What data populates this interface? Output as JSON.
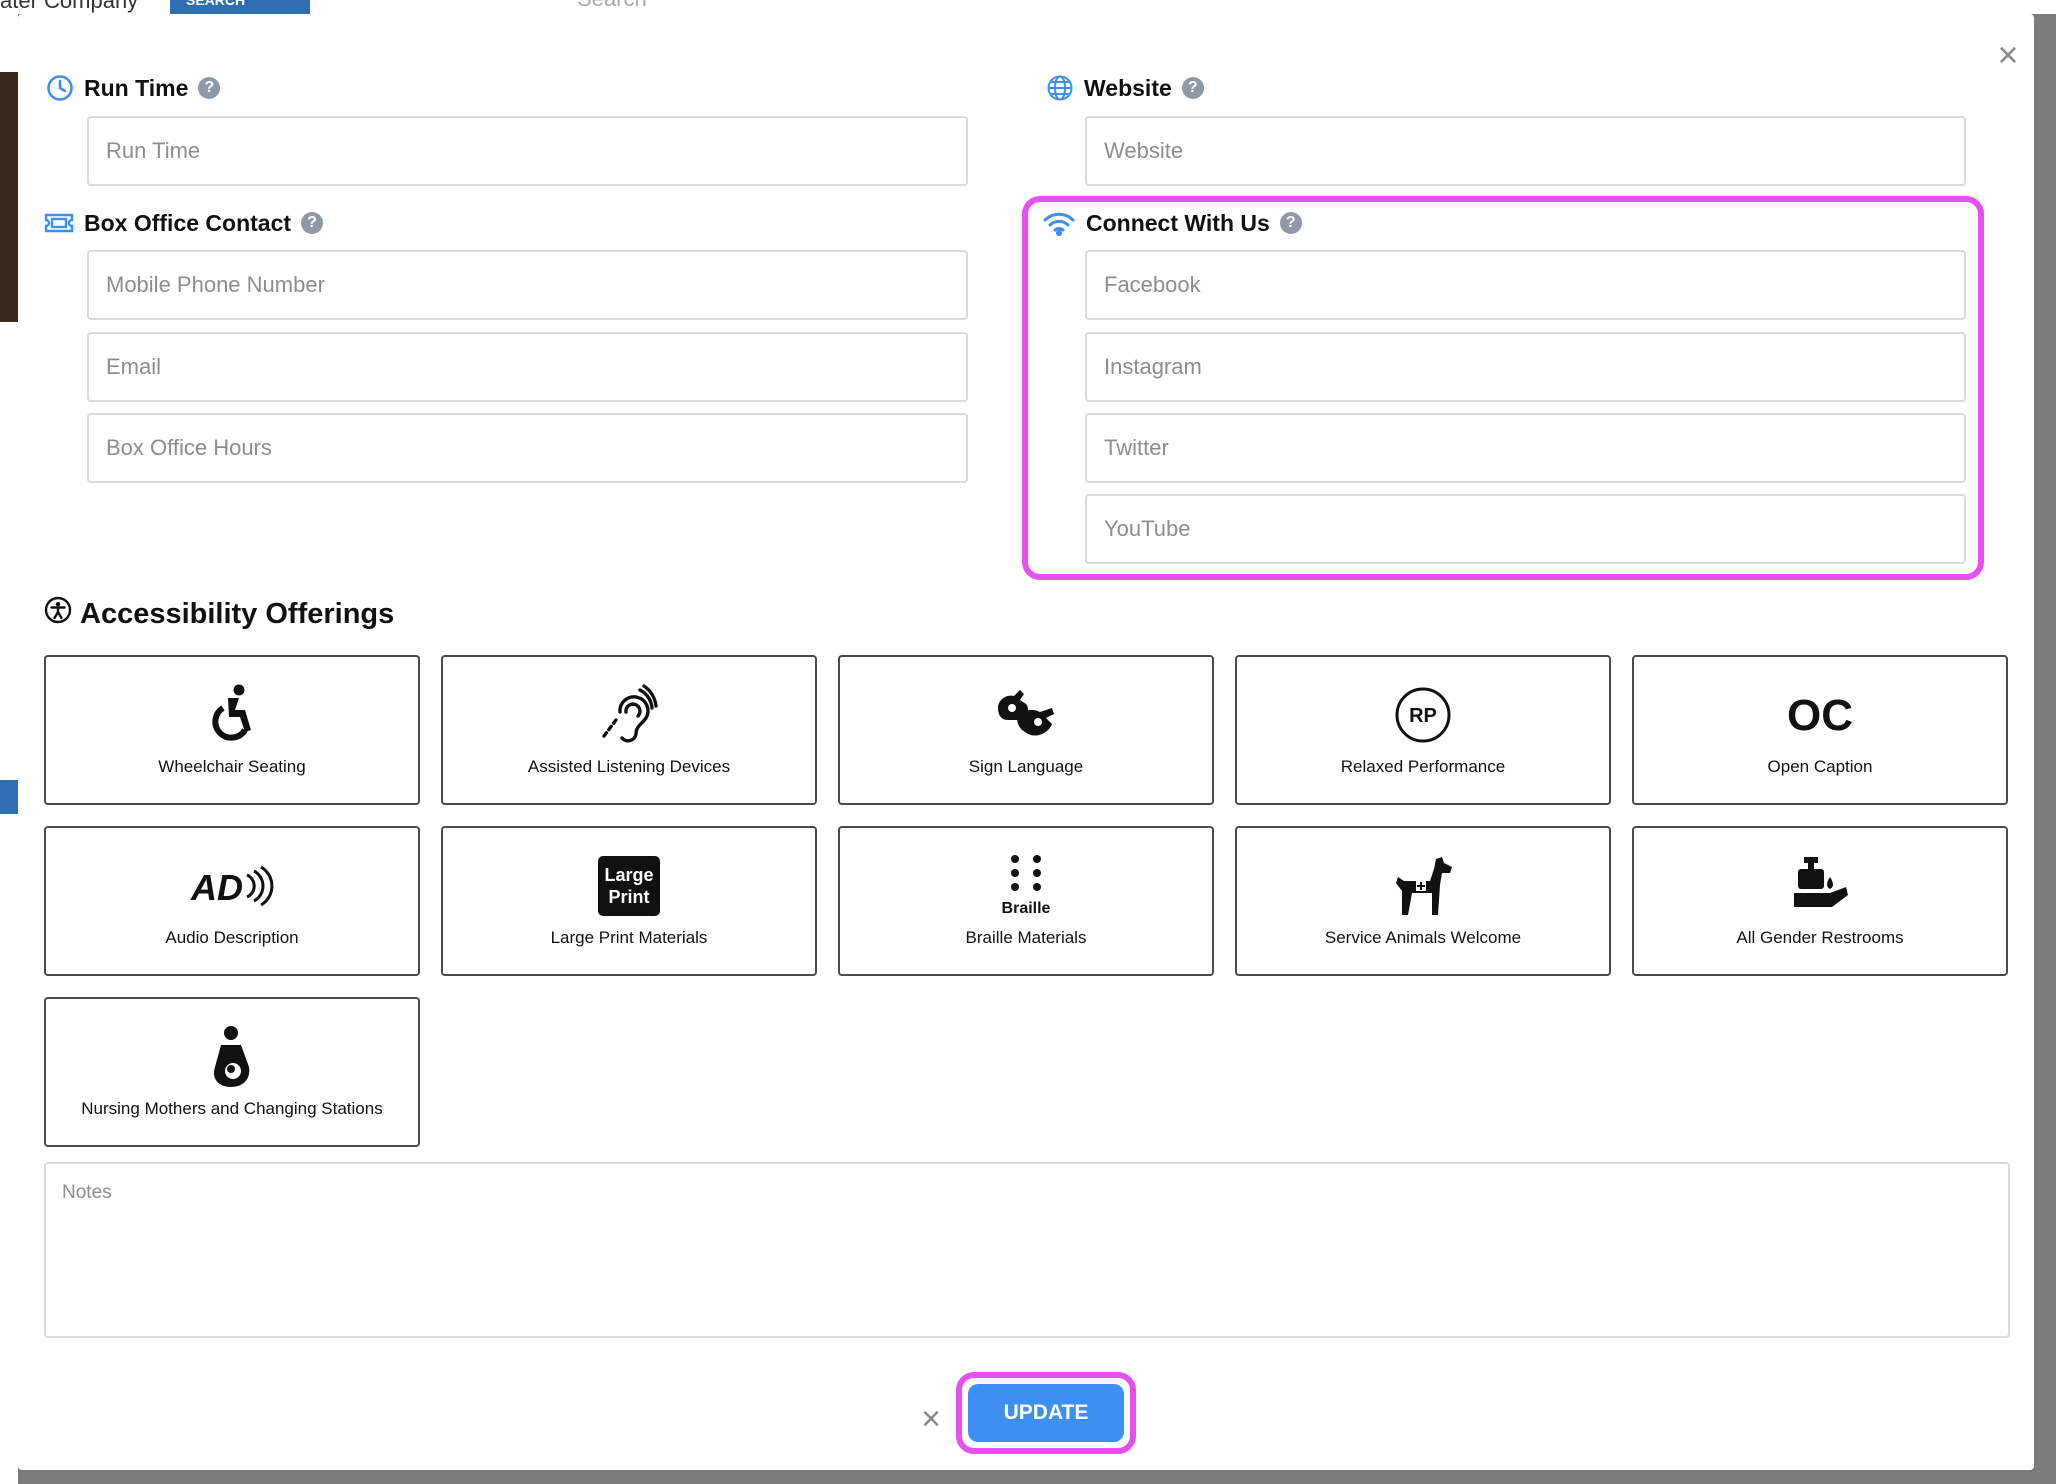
{
  "background": {
    "company_text": "ater Company",
    "search_button_label": "SEARCH",
    "search_placeholder": "Search"
  },
  "modal": {
    "close_label": "×",
    "run_time": {
      "label": "Run Time",
      "placeholder": "Run Time"
    },
    "website": {
      "label": "Website",
      "placeholder": "Website"
    },
    "box_office": {
      "label": "Box Office Contact",
      "phone_placeholder": "Mobile Phone Number",
      "email_placeholder": "Email",
      "hours_placeholder": "Box Office Hours"
    },
    "connect": {
      "label": "Connect With Us",
      "facebook_placeholder": "Facebook",
      "instagram_placeholder": "Instagram",
      "twitter_placeholder": "Twitter",
      "youtube_placeholder": "YouTube"
    },
    "accessibility": {
      "title": "Accessibility Offerings",
      "offerings": [
        {
          "label": "Wheelchair Seating",
          "icon": "wheelchair-icon"
        },
        {
          "label": "Assisted Listening Devices",
          "icon": "assisted-listening-icon"
        },
        {
          "label": "Sign Language",
          "icon": "sign-language-icon"
        },
        {
          "label": "Relaxed Performance",
          "icon": "relaxed-performance-icon",
          "icon_text": "RP"
        },
        {
          "label": "Open Caption",
          "icon": "open-caption-icon",
          "icon_text": "OC"
        },
        {
          "label": "Audio Description",
          "icon": "audio-description-icon",
          "icon_text": "AD"
        },
        {
          "label": "Large Print Materials",
          "icon": "large-print-icon",
          "icon_text_1": "Large",
          "icon_text_2": "Print"
        },
        {
          "label": "Braille Materials",
          "icon": "braille-icon",
          "icon_text": "Braille"
        },
        {
          "label": "Service Animals Welcome",
          "icon": "service-animal-icon"
        },
        {
          "label": "All Gender Restrooms",
          "icon": "restroom-icon"
        },
        {
          "label": "Nursing Mothers and Changing Stations",
          "icon": "nursing-icon"
        }
      ]
    },
    "notes_placeholder": "Notes",
    "cancel_label": "×",
    "update_label": "UPDATE"
  },
  "colors": {
    "accent_blue": "#3d8ff2",
    "highlight_magenta": "#e64ff0",
    "help_gray": "#8f98a6"
  }
}
